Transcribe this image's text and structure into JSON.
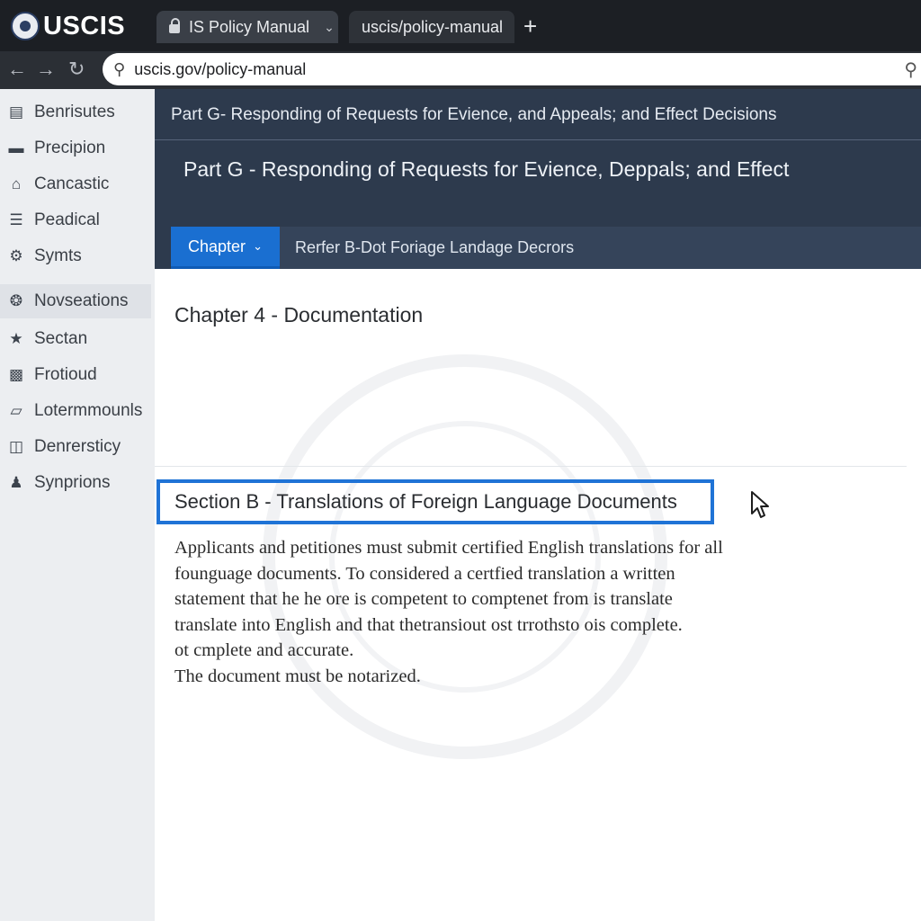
{
  "browser": {
    "brand": "USCIS",
    "tabs": [
      {
        "label": "IS Policy Manual"
      },
      {
        "label": "uscis/policy-manual"
      }
    ],
    "new_tab": "+",
    "url": "uscis.gov/policy-manual"
  },
  "sidebar": {
    "items": [
      {
        "label": "Benrisutes",
        "icon": "form-icon"
      },
      {
        "label": "Precipion",
        "icon": "card-icon"
      },
      {
        "label": "Cancastic",
        "icon": "building-icon"
      },
      {
        "label": "Peadical",
        "icon": "list-icon"
      },
      {
        "label": "Symts",
        "icon": "gear-icon"
      },
      {
        "label": "Novseations",
        "icon": "network-icon"
      },
      {
        "label": "Sectan",
        "icon": "star-icon"
      },
      {
        "label": "Frotioud",
        "icon": "image-icon"
      },
      {
        "label": "Lotermmounls",
        "icon": "chart-icon"
      },
      {
        "label": "Denrersticy",
        "icon": "document-icon"
      },
      {
        "label": "Synprions",
        "icon": "user-icon"
      }
    ]
  },
  "header": {
    "breadcrumb": "Part G- Responding of Requests for Evience, and Appeals; and Effect Decisions",
    "title": "Part G - Responding of Requests for Evience, Deppals; and Effect",
    "chapter_button": "Chapter",
    "subnav_link": "Rerfer B-Dot Foriage Landage Decrors"
  },
  "content": {
    "chapter_heading": "Chapter 4 - Documentation",
    "section_title": "Section B - Translations of Foreign Language Documents",
    "body_lines": [
      "Applicants and petitiones must submit certified English translations for all",
      "founguage documents. To considered a certfied translation a written",
      "statement that he he ore is competent to comptenet from is translate",
      "translate into English and that thetransiout ost trrothsto ois complete.",
      "ot cmplete and accurate.",
      "The document must be notarized."
    ]
  },
  "colors": {
    "header_bg": "#2d3a4d",
    "accent": "#1a6fd1",
    "highlight_border": "#1f73d6"
  }
}
